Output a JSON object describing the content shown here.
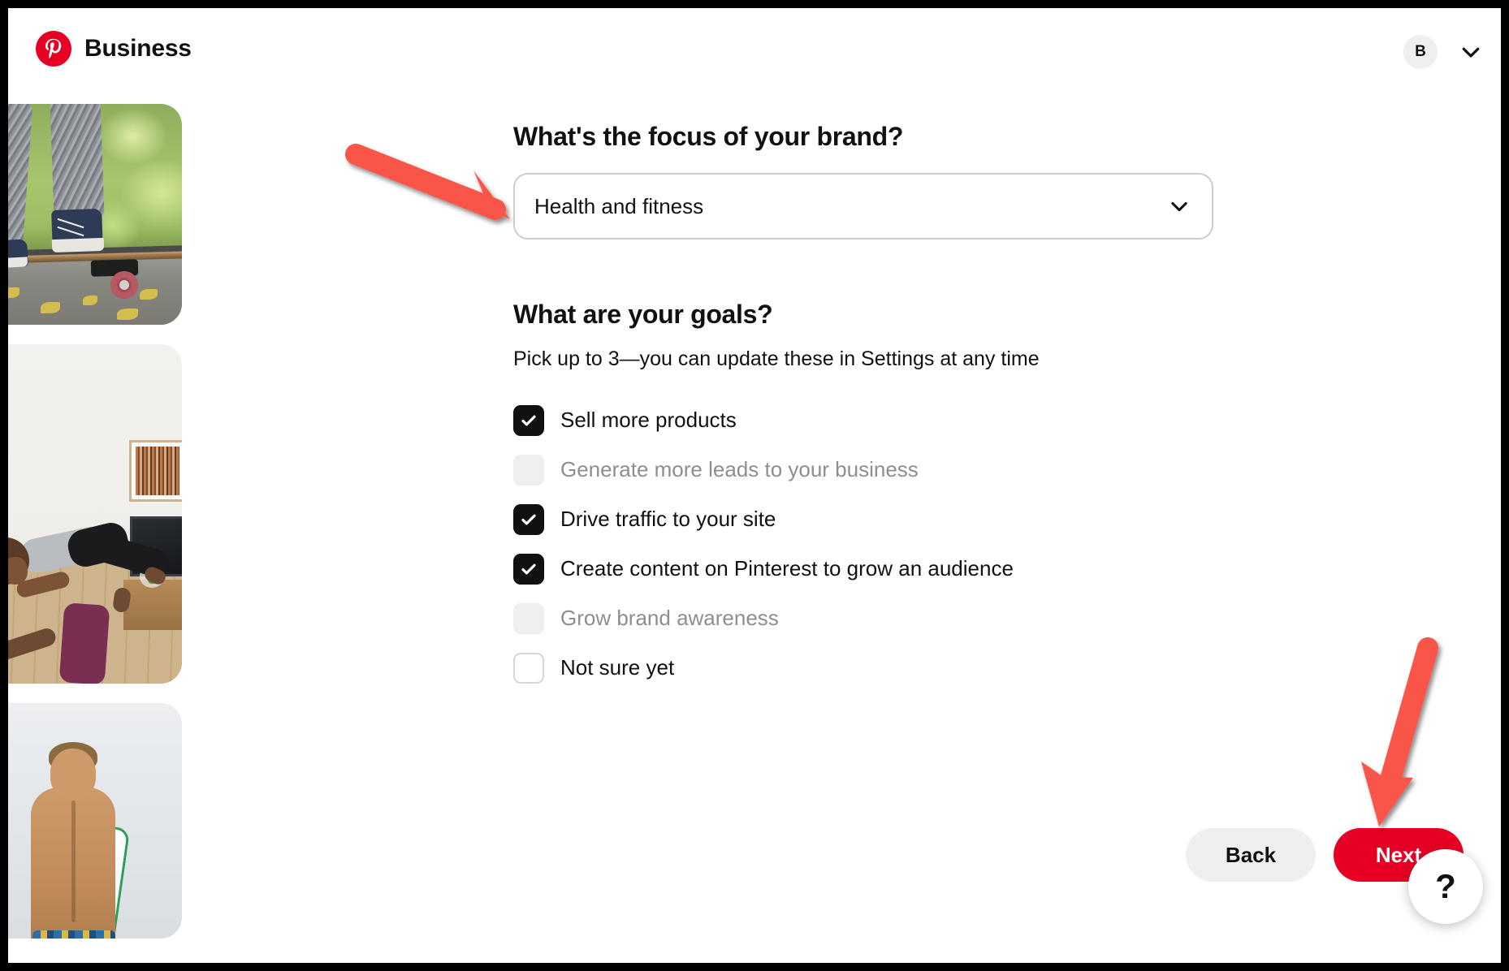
{
  "header": {
    "logo_icon": "pinterest-logo-icon",
    "brand_name": "Business",
    "avatar_initial": "B",
    "account_chevron_icon": "chevron-down-icon"
  },
  "photos": [
    {
      "name": "skateboarder-photo",
      "alt": "Person standing on a skateboard on a leaf covered path"
    },
    {
      "name": "acro-yoga-photo",
      "alt": "Two people doing acro yoga in a living room"
    },
    {
      "name": "surfer-photo",
      "alt": "Surfer carrying a board seen from behind"
    }
  ],
  "focus": {
    "title": "What's the focus of your brand?",
    "selected_value": "Health and fitness",
    "chevron_icon": "chevron-down-icon"
  },
  "goals": {
    "title": "What are your goals?",
    "help_text": "Pick up to 3—you can update these in Settings at any time",
    "items": [
      {
        "label": "Sell more products",
        "state": "checked"
      },
      {
        "label": "Generate more leads to your business",
        "state": "disabled"
      },
      {
        "label": "Drive traffic to your site",
        "state": "checked"
      },
      {
        "label": "Create content on Pinterest to grow an audience",
        "state": "checked"
      },
      {
        "label": "Grow brand awareness",
        "state": "disabled"
      },
      {
        "label": "Not sure yet",
        "state": "unchecked"
      }
    ]
  },
  "footer": {
    "back_label": "Back",
    "next_label": "Next",
    "help_label": "?"
  },
  "annotations": [
    {
      "name": "arrow-pointing-to-brand-focus-select",
      "color": "#f9544a",
      "direction": "down-right"
    },
    {
      "name": "arrow-pointing-to-next-button",
      "color": "#f9544a",
      "direction": "down-left"
    }
  ],
  "colors": {
    "brand_red": "#e60023",
    "annotation_red": "#f9544a",
    "text_primary": "#111111",
    "text_muted": "#8e8e8e",
    "surface_gray": "#efefef"
  }
}
